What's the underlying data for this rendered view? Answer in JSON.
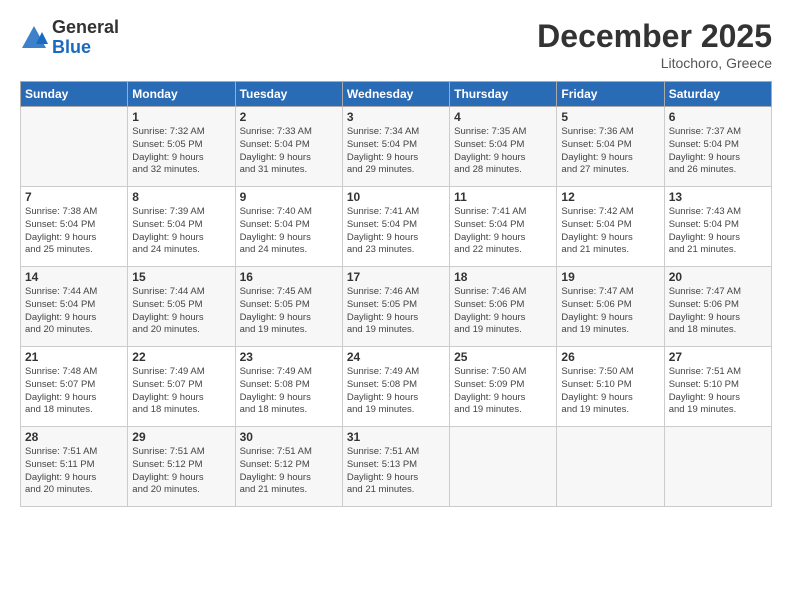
{
  "logo": {
    "general": "General",
    "blue": "Blue"
  },
  "title": "December 2025",
  "location": "Litochoro, Greece",
  "headers": [
    "Sunday",
    "Monday",
    "Tuesday",
    "Wednesday",
    "Thursday",
    "Friday",
    "Saturday"
  ],
  "weeks": [
    [
      {
        "day": "",
        "info": ""
      },
      {
        "day": "1",
        "info": "Sunrise: 7:32 AM\nSunset: 5:05 PM\nDaylight: 9 hours\nand 32 minutes."
      },
      {
        "day": "2",
        "info": "Sunrise: 7:33 AM\nSunset: 5:04 PM\nDaylight: 9 hours\nand 31 minutes."
      },
      {
        "day": "3",
        "info": "Sunrise: 7:34 AM\nSunset: 5:04 PM\nDaylight: 9 hours\nand 29 minutes."
      },
      {
        "day": "4",
        "info": "Sunrise: 7:35 AM\nSunset: 5:04 PM\nDaylight: 9 hours\nand 28 minutes."
      },
      {
        "day": "5",
        "info": "Sunrise: 7:36 AM\nSunset: 5:04 PM\nDaylight: 9 hours\nand 27 minutes."
      },
      {
        "day": "6",
        "info": "Sunrise: 7:37 AM\nSunset: 5:04 PM\nDaylight: 9 hours\nand 26 minutes."
      }
    ],
    [
      {
        "day": "7",
        "info": "Sunrise: 7:38 AM\nSunset: 5:04 PM\nDaylight: 9 hours\nand 25 minutes."
      },
      {
        "day": "8",
        "info": "Sunrise: 7:39 AM\nSunset: 5:04 PM\nDaylight: 9 hours\nand 24 minutes."
      },
      {
        "day": "9",
        "info": "Sunrise: 7:40 AM\nSunset: 5:04 PM\nDaylight: 9 hours\nand 24 minutes."
      },
      {
        "day": "10",
        "info": "Sunrise: 7:41 AM\nSunset: 5:04 PM\nDaylight: 9 hours\nand 23 minutes."
      },
      {
        "day": "11",
        "info": "Sunrise: 7:41 AM\nSunset: 5:04 PM\nDaylight: 9 hours\nand 22 minutes."
      },
      {
        "day": "12",
        "info": "Sunrise: 7:42 AM\nSunset: 5:04 PM\nDaylight: 9 hours\nand 21 minutes."
      },
      {
        "day": "13",
        "info": "Sunrise: 7:43 AM\nSunset: 5:04 PM\nDaylight: 9 hours\nand 21 minutes."
      }
    ],
    [
      {
        "day": "14",
        "info": "Sunrise: 7:44 AM\nSunset: 5:04 PM\nDaylight: 9 hours\nand 20 minutes."
      },
      {
        "day": "15",
        "info": "Sunrise: 7:44 AM\nSunset: 5:05 PM\nDaylight: 9 hours\nand 20 minutes."
      },
      {
        "day": "16",
        "info": "Sunrise: 7:45 AM\nSunset: 5:05 PM\nDaylight: 9 hours\nand 19 minutes."
      },
      {
        "day": "17",
        "info": "Sunrise: 7:46 AM\nSunset: 5:05 PM\nDaylight: 9 hours\nand 19 minutes."
      },
      {
        "day": "18",
        "info": "Sunrise: 7:46 AM\nSunset: 5:06 PM\nDaylight: 9 hours\nand 19 minutes."
      },
      {
        "day": "19",
        "info": "Sunrise: 7:47 AM\nSunset: 5:06 PM\nDaylight: 9 hours\nand 19 minutes."
      },
      {
        "day": "20",
        "info": "Sunrise: 7:47 AM\nSunset: 5:06 PM\nDaylight: 9 hours\nand 18 minutes."
      }
    ],
    [
      {
        "day": "21",
        "info": "Sunrise: 7:48 AM\nSunset: 5:07 PM\nDaylight: 9 hours\nand 18 minutes."
      },
      {
        "day": "22",
        "info": "Sunrise: 7:49 AM\nSunset: 5:07 PM\nDaylight: 9 hours\nand 18 minutes."
      },
      {
        "day": "23",
        "info": "Sunrise: 7:49 AM\nSunset: 5:08 PM\nDaylight: 9 hours\nand 18 minutes."
      },
      {
        "day": "24",
        "info": "Sunrise: 7:49 AM\nSunset: 5:08 PM\nDaylight: 9 hours\nand 19 minutes."
      },
      {
        "day": "25",
        "info": "Sunrise: 7:50 AM\nSunset: 5:09 PM\nDaylight: 9 hours\nand 19 minutes."
      },
      {
        "day": "26",
        "info": "Sunrise: 7:50 AM\nSunset: 5:10 PM\nDaylight: 9 hours\nand 19 minutes."
      },
      {
        "day": "27",
        "info": "Sunrise: 7:51 AM\nSunset: 5:10 PM\nDaylight: 9 hours\nand 19 minutes."
      }
    ],
    [
      {
        "day": "28",
        "info": "Sunrise: 7:51 AM\nSunset: 5:11 PM\nDaylight: 9 hours\nand 20 minutes."
      },
      {
        "day": "29",
        "info": "Sunrise: 7:51 AM\nSunset: 5:12 PM\nDaylight: 9 hours\nand 20 minutes."
      },
      {
        "day": "30",
        "info": "Sunrise: 7:51 AM\nSunset: 5:12 PM\nDaylight: 9 hours\nand 21 minutes."
      },
      {
        "day": "31",
        "info": "Sunrise: 7:51 AM\nSunset: 5:13 PM\nDaylight: 9 hours\nand 21 minutes."
      },
      {
        "day": "",
        "info": ""
      },
      {
        "day": "",
        "info": ""
      },
      {
        "day": "",
        "info": ""
      }
    ]
  ]
}
